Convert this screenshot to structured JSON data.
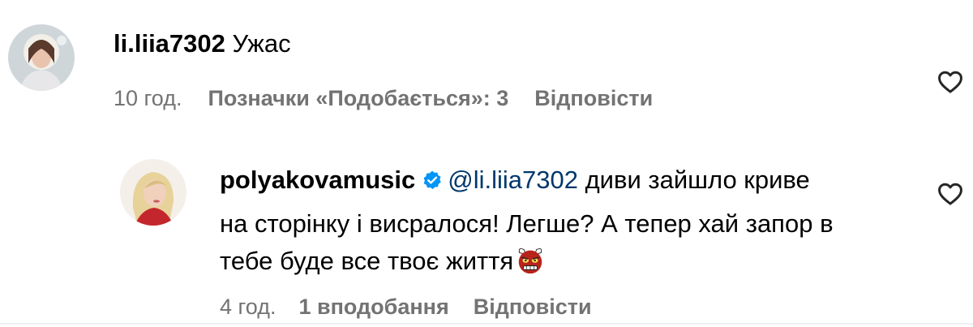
{
  "comment": {
    "username": "li.liia7302",
    "text": "Ужас",
    "time": "10 год.",
    "likes": "Позначки «Подобається»: 3",
    "reply": "Відповісти",
    "like_icon": "heart-outline-icon"
  },
  "reply_comment": {
    "username": "polyakovamusic",
    "mention": "@li.liia7302",
    "text_line1": "диви зайшло криве",
    "text_line2": "на сторінку і висралося! Легше? А тепер хай запор в",
    "text_line3": "тебе буде все твоє життя",
    "time": "4 год.",
    "likes": "1 вподобання",
    "reply": "Відповісти",
    "verified_icon": "verified-badge-icon",
    "emoji_icon": "devil-face-emoji",
    "like_icon": "heart-outline-icon",
    "accent_color": "#0095f6",
    "mention_color": "#00376b"
  }
}
